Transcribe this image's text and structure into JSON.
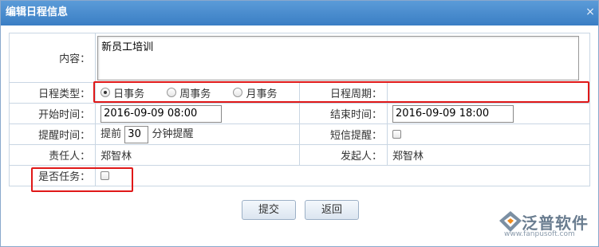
{
  "dialog": {
    "title": "编辑日程信息",
    "close_glyph": "×"
  },
  "form": {
    "content": {
      "label": "内容：",
      "value": "新员工培训"
    },
    "schedule_type": {
      "label": "日程类型：",
      "options": [
        {
          "label": "日事务",
          "checked": true
        },
        {
          "label": "周事务",
          "checked": false
        },
        {
          "label": "月事务",
          "checked": false
        }
      ]
    },
    "schedule_period": {
      "label": "日程周期：",
      "value": ""
    },
    "start_time": {
      "label": "开始时间：",
      "value": "2016-09-09 08:00"
    },
    "end_time": {
      "label": "结束时间：",
      "value": "2016-09-09 18:00"
    },
    "reminder": {
      "label": "提醒时间：",
      "prefix": "提前",
      "minutes": "30",
      "suffix": "分钟提醒"
    },
    "sms": {
      "label": "短信提醒：",
      "checked": false
    },
    "owner": {
      "label": "责任人：",
      "value": "郑智林"
    },
    "initiator": {
      "label": "发起人：",
      "value": "郑智林"
    },
    "is_task": {
      "label": "是否任务：",
      "checked": false
    }
  },
  "buttons": {
    "submit": "提交",
    "back": "返回"
  },
  "logo": {
    "text": "泛普软件",
    "url": "www.fanpusoft.com"
  },
  "colors": {
    "titlebar": "#4a8dcf",
    "highlight": "#e01818"
  }
}
